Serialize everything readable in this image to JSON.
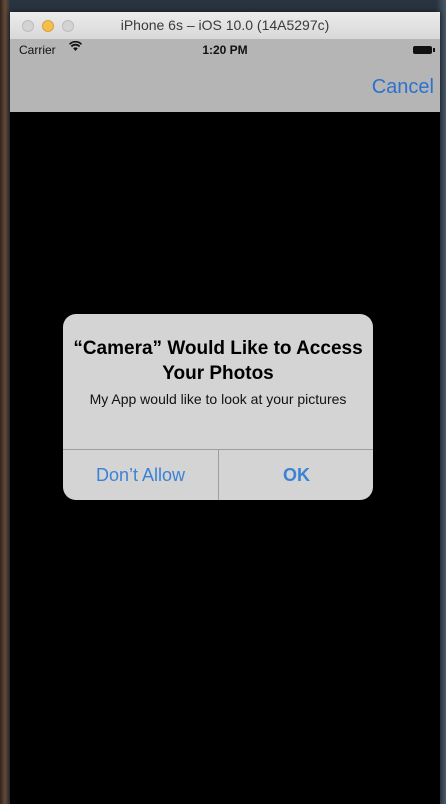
{
  "window": {
    "title": "iPhone 6s – iOS 10.0 (14A5297c)"
  },
  "status_bar": {
    "carrier": "Carrier",
    "time": "1:20 PM"
  },
  "nav": {
    "cancel_label": "Cancel"
  },
  "alert": {
    "title": "“Camera” Would Like to Access Your Photos",
    "message": "My App would like to look at your pictures",
    "deny_label": "Don’t Allow",
    "ok_label": "OK"
  },
  "colors": {
    "accent": "#2b72cf",
    "alert_bg": "#d4d4d4",
    "nav_bg": "#b5b5b5"
  },
  "icons": {
    "wifi": "wifi-icon",
    "battery": "battery-icon"
  }
}
